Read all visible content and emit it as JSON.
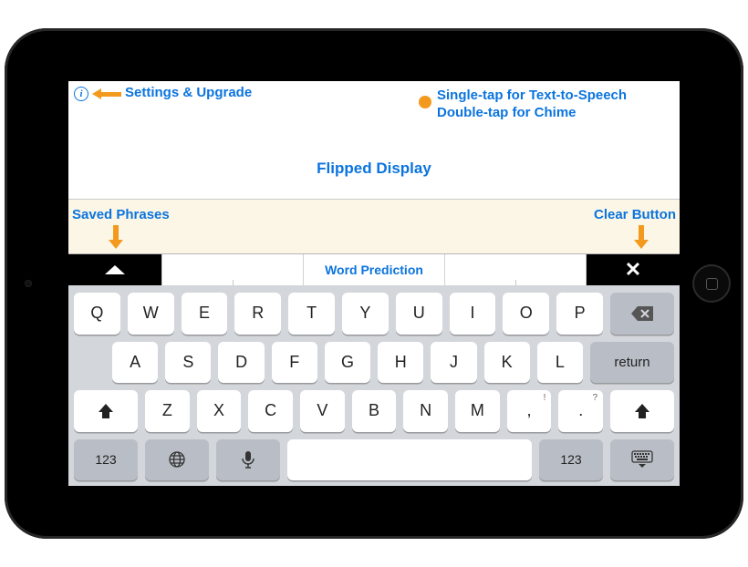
{
  "annotations": {
    "settings": "Settings & Upgrade",
    "tts_line1": "Single-tap for Text-to-Speech",
    "tts_line2": "Double-tap for Chime",
    "flipped": "Flipped Display",
    "saved": "Saved Phrases",
    "clear": "Clear Button",
    "word_prediction": "Word Prediction"
  },
  "keyboard": {
    "row1": [
      "Q",
      "W",
      "E",
      "R",
      "T",
      "Y",
      "U",
      "I",
      "O",
      "P"
    ],
    "row2": [
      "A",
      "S",
      "D",
      "F",
      "G",
      "H",
      "J",
      "K",
      "L"
    ],
    "row3": [
      "Z",
      "X",
      "C",
      "V",
      "B",
      "N",
      "M"
    ],
    "punct": {
      "comma_main": ",",
      "comma_alt": "!",
      "period_main": ".",
      "period_alt": "?"
    },
    "return": "return",
    "numkey": "123"
  }
}
